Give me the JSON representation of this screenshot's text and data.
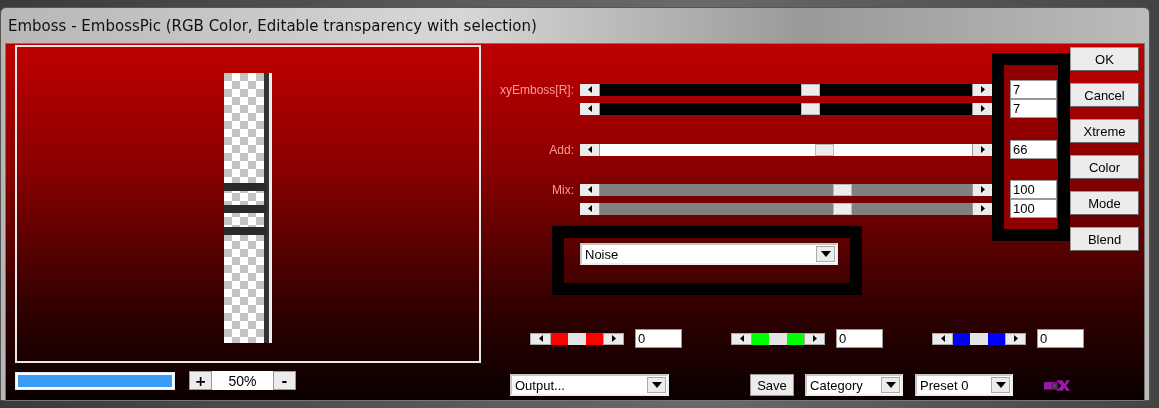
{
  "window": {
    "title": "Emboss - EmbossPic (RGB Color, Editable transparency with selection)"
  },
  "preview": {
    "progress": {
      "level": 1
    },
    "zoom": {
      "plus": "+",
      "value": "50%",
      "minus": "-"
    }
  },
  "sliders": [
    {
      "label": "xyEmboss[R]:",
      "kind": "dark",
      "level": 0.57,
      "value": "7"
    },
    {
      "kind": "dark",
      "level": 0.57,
      "value": "7"
    },
    {
      "label": "Add:",
      "kind": "light",
      "level": 0.61,
      "value": "66"
    },
    {
      "label": "Mix:",
      "kind": "grey",
      "level": 0.66,
      "value": "100"
    },
    {
      "kind": "grey",
      "level": 0.66,
      "value": "100"
    }
  ],
  "mode_dropdown": {
    "value": "Noise"
  },
  "color_sliders": [
    {
      "color": "#ff0000",
      "value": "0"
    },
    {
      "color": "#00ff00",
      "value": "0"
    },
    {
      "color": "#0000ff",
      "value": "0"
    }
  ],
  "buttons": [
    "OK",
    "Cancel",
    "Xtreme",
    "Color",
    "Mode",
    "Blend"
  ],
  "bottom_bar": {
    "output": "Output...",
    "save": "Save",
    "category": "Category",
    "preset": "Preset 0"
  }
}
